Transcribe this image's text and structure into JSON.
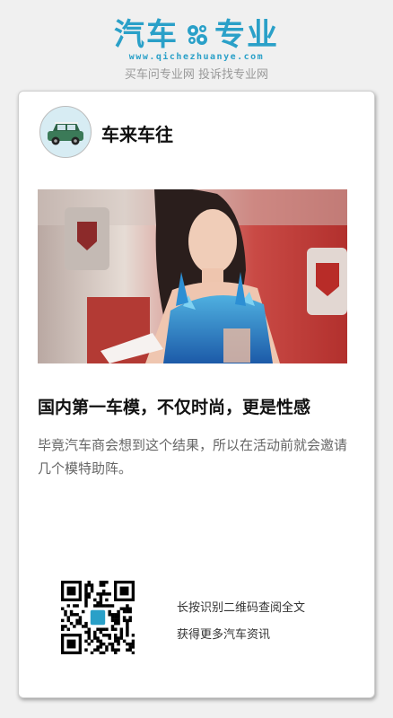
{
  "brand": {
    "logo_left": "汽车",
    "logo_right": "专业",
    "url": "www.qichezhuanye.com",
    "slogan": "买车问专业网 投诉找专业网",
    "color": "#2aa0c8"
  },
  "card": {
    "author": "车来车往",
    "avatar_icon": "car-avatar-icon",
    "article": {
      "title": "国内第一车模，不仅时尚，更是性感",
      "summary": "毕竟汽车商会想到这个结果，所以在活动前就会邀请几个模特助阵。"
    },
    "qr": {
      "line1": "长按识别二维码查阅全文",
      "line2": "获得更多汽车资讯",
      "icon": "qr-code-icon"
    }
  }
}
